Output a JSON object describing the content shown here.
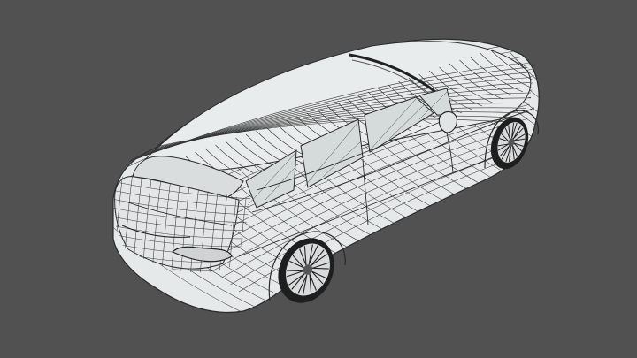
{
  "viewport": {
    "background": "#515151",
    "shading": "solid-wireframe",
    "subject": "station-wagon-mesh"
  },
  "colors": {
    "surface": "#e6e9e9",
    "wire": "#2a2a2a",
    "glass": "#cfd4d4",
    "tire": "#1e1e1e"
  }
}
